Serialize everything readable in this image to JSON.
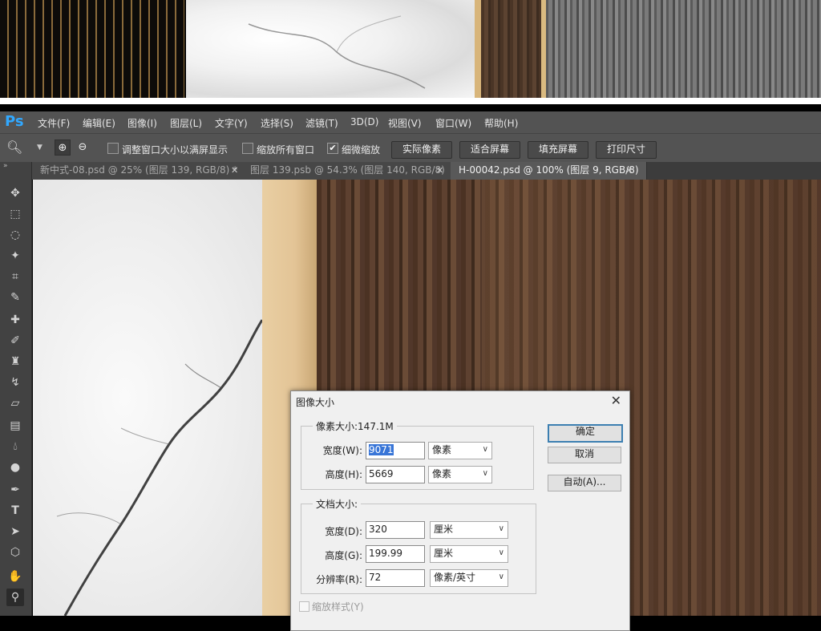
{
  "app": {
    "logo": "Ps"
  },
  "menu": [
    "文件(F)",
    "编辑(E)",
    "图像(I)",
    "图层(L)",
    "文字(Y)",
    "选择(S)",
    "滤镜(T)",
    "3D(D)",
    "视图(V)",
    "窗口(W)",
    "帮助(H)"
  ],
  "options": {
    "resize_windows_label": "调整窗口大小以满屏显示",
    "zoom_all_label": "缩放所有窗口",
    "scrubby_zoom_label": "细微缩放",
    "scrubby_zoom_checked": true,
    "buttons": [
      "实际像素",
      "适合屏幕",
      "填充屏幕",
      "打印尺寸"
    ]
  },
  "tabs": [
    {
      "label": "新中式-08.psd @ 25% (图层 139, RGB/8) *",
      "active": false
    },
    {
      "label": "图层 139.psb @ 54.3% (图层 140, RGB/8)",
      "active": false
    },
    {
      "label": "H-00042.psd @ 100% (图层 9, RGB/8)",
      "active": true
    }
  ],
  "tools": [
    "move-tool",
    "marquee-tool",
    "lasso-tool",
    "magic-wand-tool",
    "crop-tool",
    "eyedropper-tool",
    "healing-brush-tool",
    "brush-tool",
    "clone-stamp-tool",
    "history-brush-tool",
    "eraser-tool",
    "gradient-tool",
    "blur-tool",
    "dodge-tool",
    "pen-tool",
    "type-tool",
    "path-selection-tool",
    "shape-tool",
    "hand-tool",
    "zoom-tool"
  ],
  "dialog": {
    "title": "图像大小",
    "close": "✕",
    "pixel_dimensions": {
      "title": "像素大小:147.1M",
      "width_label": "宽度(W):",
      "width_value": "9071",
      "width_unit": "像素",
      "height_label": "高度(H):",
      "height_value": "5669",
      "height_unit": "像素"
    },
    "document_size": {
      "title": "文档大小:",
      "width_label": "宽度(D):",
      "width_value": "320",
      "width_unit": "厘米",
      "height_label": "高度(G):",
      "height_value": "199.99",
      "height_unit": "厘米",
      "resolution_label": "分辨率(R):",
      "resolution_value": "72",
      "resolution_unit": "像素/英寸"
    },
    "ok_label": "确定",
    "cancel_label": "取消",
    "auto_label": "自动(A)...",
    "scale_styles_label": "缩放样式(Y)"
  }
}
